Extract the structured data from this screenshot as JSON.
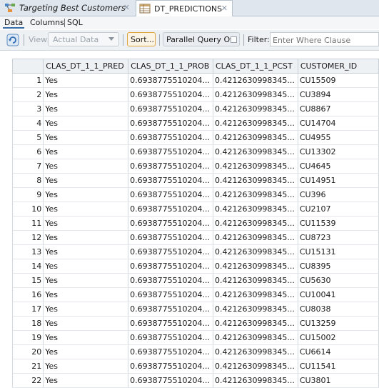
{
  "tabs": [
    {
      "label": "Targeting Best Customers"
    },
    {
      "label": "DT_PREDICTIONS"
    }
  ],
  "subtabs": [
    "Data",
    "Columns",
    "SQL"
  ],
  "toolbar": {
    "view_label": "View:",
    "view_value": "Actual Data",
    "sort_label": "Sort...",
    "parallel_label": "Parallel Query Off",
    "filter_label": "Filter:",
    "filter_placeholder": "Enter Where Clause"
  },
  "grid": {
    "columns": [
      "CLAS_DT_1_1_PRED",
      "CLAS_DT_1_1_PROB",
      "CLAS_DT_1_1_PCST",
      "CUSTOMER_ID"
    ],
    "rows": [
      {
        "n": "1",
        "pred": "Yes",
        "prob": "0.6938775510204...",
        "pcst": "0.4212630998345...",
        "cid": "CU15509"
      },
      {
        "n": "2",
        "pred": "Yes",
        "prob": "0.6938775510204...",
        "pcst": "0.4212630998345...",
        "cid": "CU3894"
      },
      {
        "n": "3",
        "pred": "Yes",
        "prob": "0.6938775510204...",
        "pcst": "0.4212630998345...",
        "cid": "CU8867"
      },
      {
        "n": "4",
        "pred": "Yes",
        "prob": "0.6938775510204...",
        "pcst": "0.4212630998345...",
        "cid": "CU14704"
      },
      {
        "n": "5",
        "pred": "Yes",
        "prob": "0.6938775510204...",
        "pcst": "0.4212630998345...",
        "cid": "CU4955"
      },
      {
        "n": "6",
        "pred": "Yes",
        "prob": "0.6938775510204...",
        "pcst": "0.4212630998345...",
        "cid": "CU13302"
      },
      {
        "n": "7",
        "pred": "Yes",
        "prob": "0.6938775510204...",
        "pcst": "0.4212630998345...",
        "cid": "CU4645"
      },
      {
        "n": "8",
        "pred": "Yes",
        "prob": "0.6938775510204...",
        "pcst": "0.4212630998345...",
        "cid": "CU14951"
      },
      {
        "n": "9",
        "pred": "Yes",
        "prob": "0.6938775510204...",
        "pcst": "0.4212630998345...",
        "cid": "CU396"
      },
      {
        "n": "10",
        "pred": "Yes",
        "prob": "0.6938775510204...",
        "pcst": "0.4212630998345...",
        "cid": "CU2107"
      },
      {
        "n": "11",
        "pred": "Yes",
        "prob": "0.6938775510204...",
        "pcst": "0.4212630998345...",
        "cid": "CU11539"
      },
      {
        "n": "12",
        "pred": "Yes",
        "prob": "0.6938775510204...",
        "pcst": "0.4212630998345...",
        "cid": "CU8723"
      },
      {
        "n": "13",
        "pred": "Yes",
        "prob": "0.6938775510204...",
        "pcst": "0.4212630998345...",
        "cid": "CU15131"
      },
      {
        "n": "14",
        "pred": "Yes",
        "prob": "0.6938775510204...",
        "pcst": "0.4212630998345...",
        "cid": "CU8395"
      },
      {
        "n": "15",
        "pred": "Yes",
        "prob": "0.6938775510204...",
        "pcst": "0.4212630998345...",
        "cid": "CU5630"
      },
      {
        "n": "16",
        "pred": "Yes",
        "prob": "0.6938775510204...",
        "pcst": "0.4212630998345...",
        "cid": "CU10041"
      },
      {
        "n": "17",
        "pred": "Yes",
        "prob": "0.6938775510204...",
        "pcst": "0.4212630998345...",
        "cid": "CU8038"
      },
      {
        "n": "18",
        "pred": "Yes",
        "prob": "0.6938775510204...",
        "pcst": "0.4212630998345...",
        "cid": "CU13259"
      },
      {
        "n": "19",
        "pred": "Yes",
        "prob": "0.6938775510204...",
        "pcst": "0.4212630998345...",
        "cid": "CU15002"
      },
      {
        "n": "20",
        "pred": "Yes",
        "prob": "0.6938775510204...",
        "pcst": "0.4212630998345...",
        "cid": "CU6614"
      },
      {
        "n": "21",
        "pred": "Yes",
        "prob": "0.6938775510204...",
        "pcst": "0.4212630998345...",
        "cid": "CU11541"
      },
      {
        "n": "22",
        "pred": "Yes",
        "prob": "0.6938775510204...",
        "pcst": "0.4212630998345...",
        "cid": "CU3801"
      }
    ]
  }
}
